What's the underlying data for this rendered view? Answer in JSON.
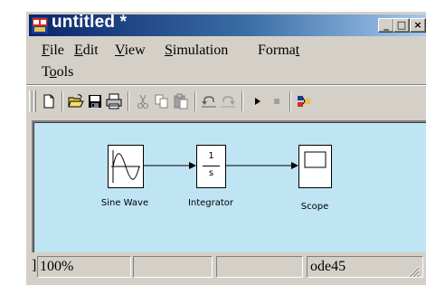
{
  "window": {
    "title": "untitled *",
    "controls": {
      "minimize": "_",
      "maximize": "□",
      "close": "×"
    }
  },
  "menu": {
    "row1": [
      {
        "pre": "",
        "ul": "F",
        "post": "ile"
      },
      {
        "pre": "",
        "ul": "E",
        "post": "dit"
      },
      {
        "pre": "",
        "ul": "V",
        "post": "iew"
      },
      {
        "pre": "",
        "ul": "S",
        "post": "imulation"
      },
      {
        "pre": "Forma",
        "ul": "t",
        "post": ""
      }
    ],
    "row2": [
      {
        "pre": "T",
        "ul": "o",
        "post": "ols"
      }
    ]
  },
  "toolbar": {
    "icons": [
      "new-document-icon",
      "open-folder-icon",
      "save-icon",
      "print-icon",
      "cut-icon",
      "copy-icon",
      "paste-icon",
      "undo-icon",
      "redo-icon",
      "play-icon",
      "stop-icon",
      "library-browser-icon"
    ]
  },
  "diagram": {
    "blocks": [
      {
        "name": "Sine Wave",
        "type": "sine-wave-source"
      },
      {
        "name": "Integrator",
        "type": "integrator",
        "numerator": "1",
        "denominator": "s"
      },
      {
        "name": "Scope",
        "type": "scope"
      }
    ]
  },
  "status": {
    "marker": "]",
    "zoom": "100%",
    "blank1": "",
    "blank2": "",
    "solver": "ode45"
  },
  "colors": {
    "canvas": "#bfe4f3",
    "title_gradient_start": "#0a246a",
    "title_gradient_end": "#a6caf0",
    "chrome": "#d4d0c8"
  }
}
